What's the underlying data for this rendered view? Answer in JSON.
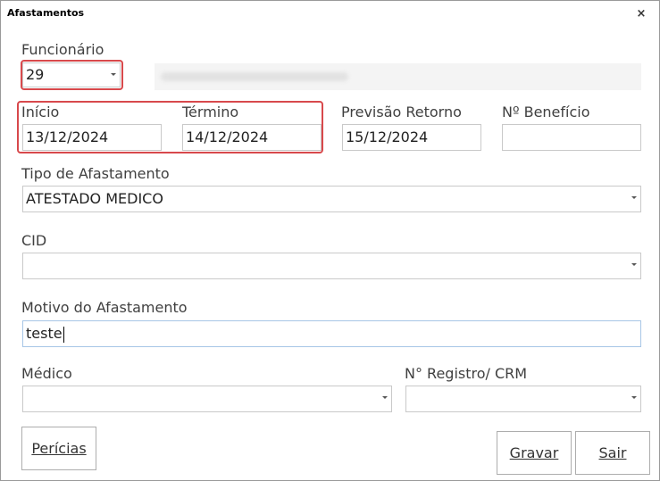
{
  "window": {
    "title": "Afastamentos",
    "close_glyph": "×"
  },
  "funcionario": {
    "label": "Funcionário",
    "code": "29",
    "name_blurred": ""
  },
  "inicio": {
    "label": "Início",
    "value": "13/12/2024"
  },
  "termino": {
    "label": "Término",
    "value": "14/12/2024"
  },
  "previsao": {
    "label": "Previsão Retorno",
    "value": "15/12/2024"
  },
  "beneficio": {
    "label": "Nº Benefício",
    "value": ""
  },
  "tipo": {
    "label": "Tipo de Afastamento",
    "value": "ATESTADO MEDICO"
  },
  "cid": {
    "label": "CID",
    "value": ""
  },
  "motivo": {
    "label": "Motivo do Afastamento",
    "value": "teste"
  },
  "medico": {
    "label": "Médico",
    "value": ""
  },
  "registro": {
    "label": "N° Registro/ CRM",
    "value": ""
  },
  "buttons": {
    "pericias": "Perícias",
    "gravar": "Gravar",
    "sair": "Sair"
  },
  "colors": {
    "highlight": "#d8494c",
    "focus_border": "#a7c6e6"
  }
}
